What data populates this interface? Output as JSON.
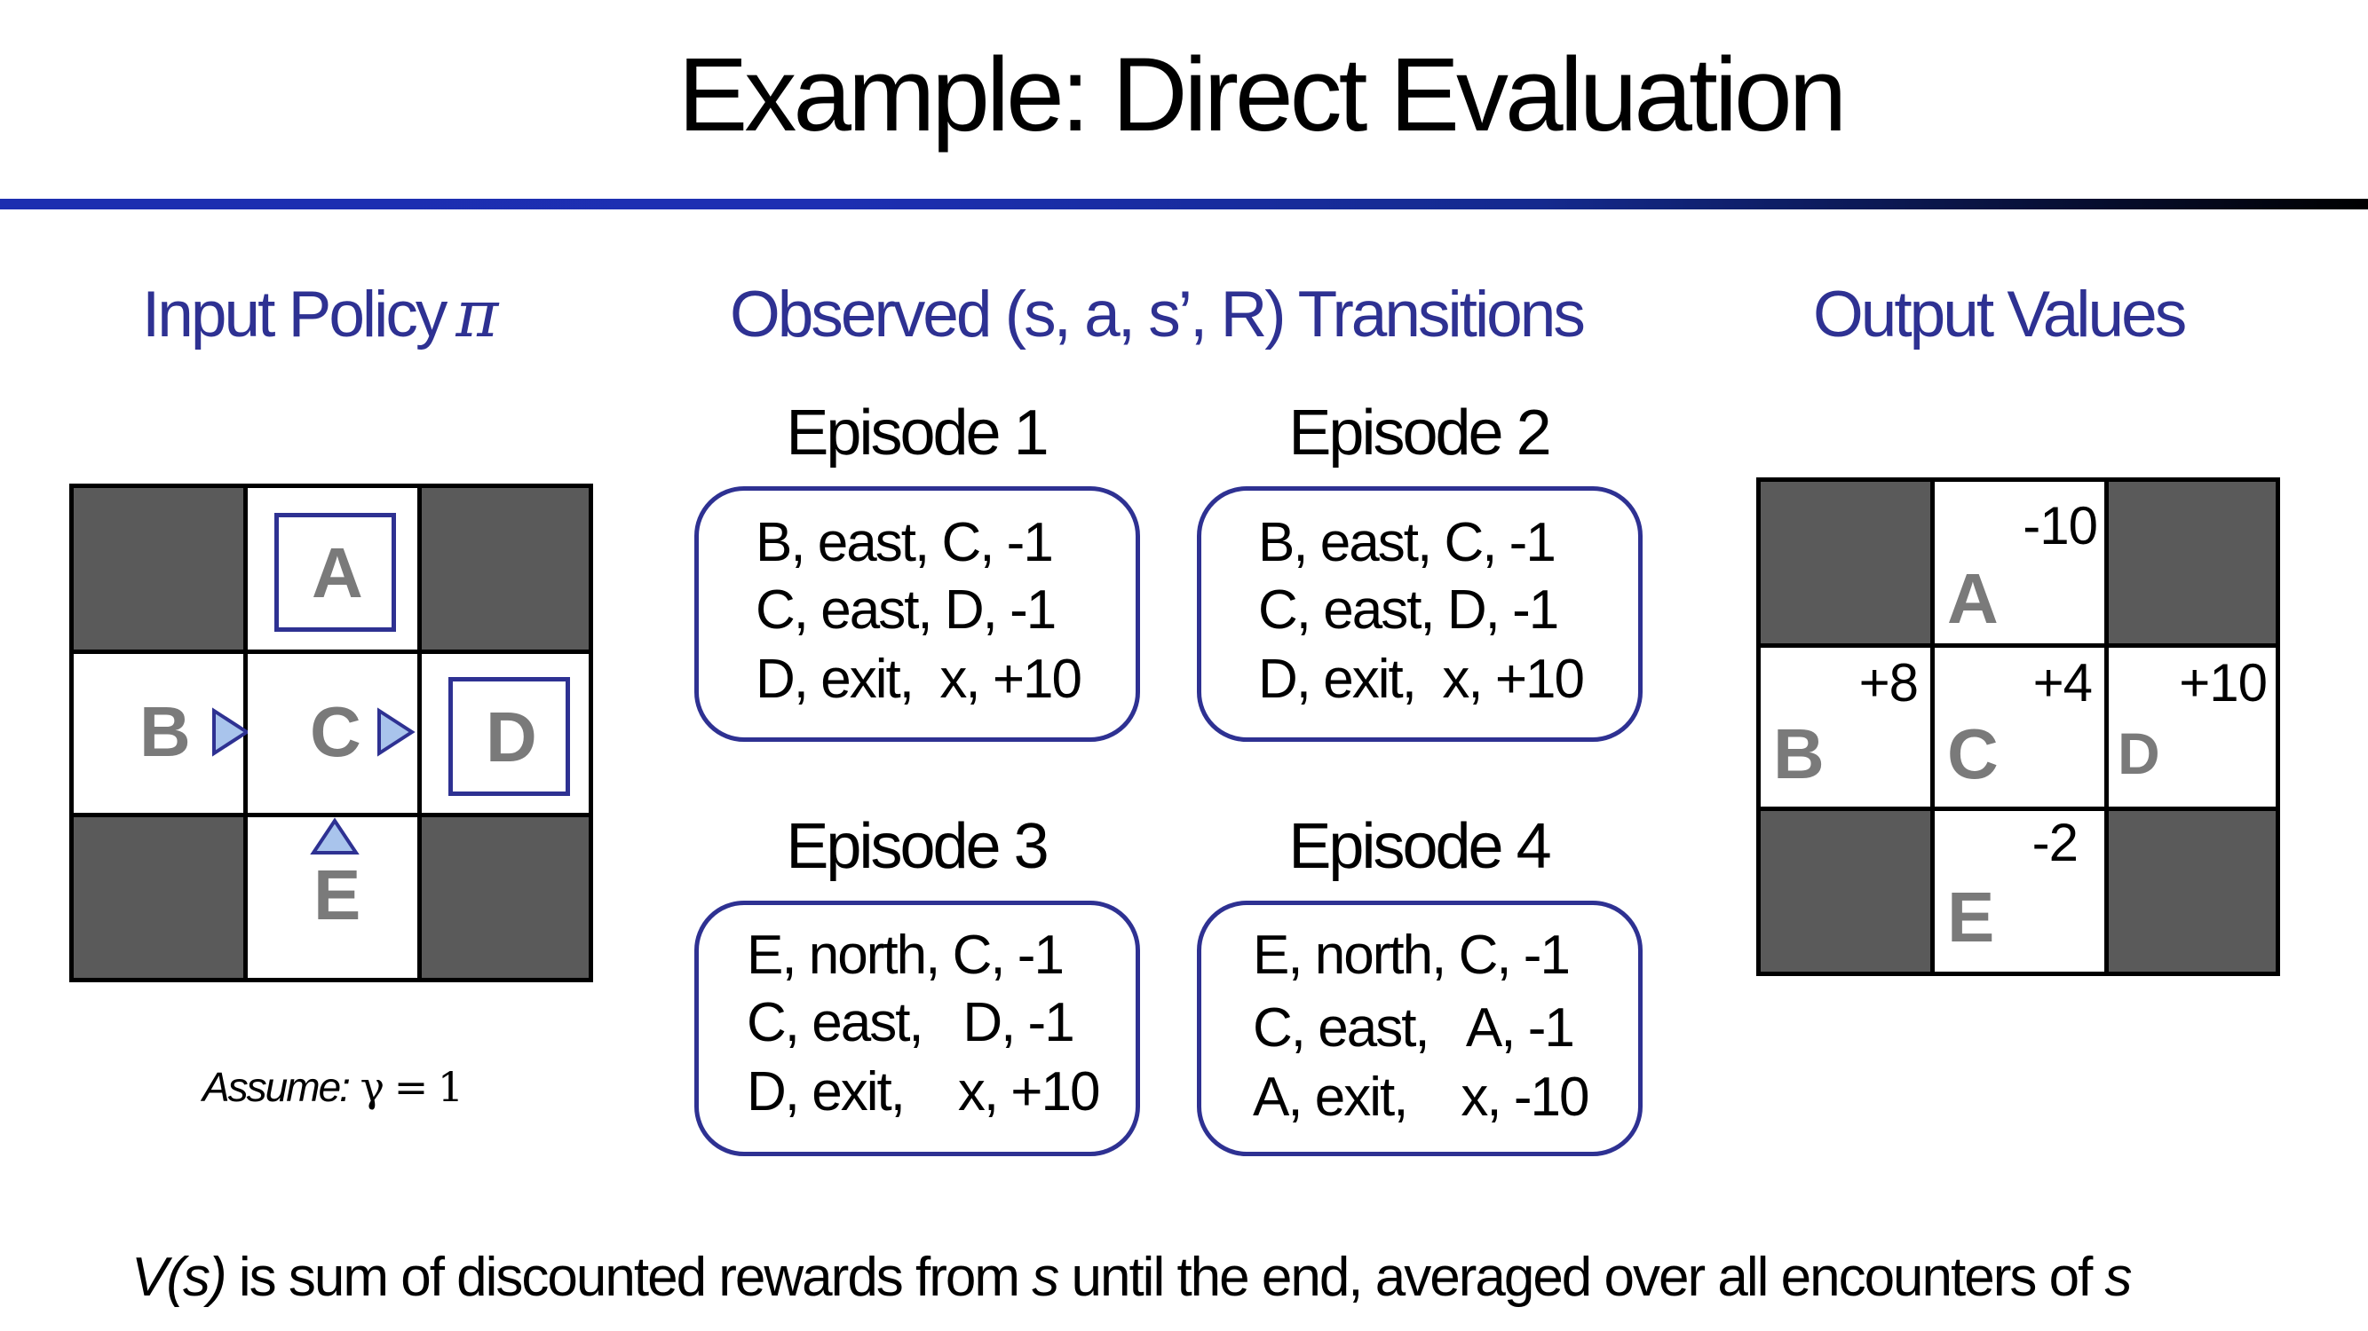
{
  "slide": {
    "title": "Example: Direct Evaluation",
    "headings": {
      "input_policy": "Input Policy",
      "pi_symbol": "π",
      "transitions": "Observed (s, a, s’, R) Transitions",
      "output_values": "Output Values"
    },
    "episodes": [
      {
        "title": "Episode 1",
        "lines": [
          "B, east, C, -1",
          "C, east, D, -1",
          "D, exit,  x, +10"
        ]
      },
      {
        "title": "Episode 2",
        "lines": [
          "B, east, C, -1",
          "C, east, D, -1",
          "D, exit,  x, +10"
        ]
      },
      {
        "title": "Episode 3",
        "lines": [
          "E, north, C, -1",
          "C, east,   D, -1",
          "D, exit,    x, +10"
        ]
      },
      {
        "title": "Episode 4",
        "lines": [
          "E, north, C, -1",
          "C, east,   A, -1",
          "A, exit,    x, -10"
        ]
      }
    ],
    "policy_grid": {
      "A": "A",
      "B": "B",
      "C": "C",
      "D": "D",
      "E": "E"
    },
    "assume": {
      "label": "Assume:",
      "expr": " γ = 1"
    },
    "output_grid": {
      "A": {
        "label": "A",
        "value": "-10"
      },
      "B": {
        "label": "B",
        "value": "+8"
      },
      "C": {
        "label": "C",
        "value": "+4"
      },
      "D": {
        "label": "D",
        "value": "+10"
      },
      "E": {
        "label": "E",
        "value": "-2"
      }
    },
    "footer": {
      "vs": "V(s)",
      "part1": " is sum of discounted rewards from ",
      "s1": "s",
      "part2": " until the end, averaged over all encounters of ",
      "s2": "s"
    },
    "colors": {
      "accent": "#2e3192",
      "dark_cell": "#5a5a5a",
      "arrow_fill": "#a9c4ec",
      "letter": "#7a7a7a"
    }
  }
}
